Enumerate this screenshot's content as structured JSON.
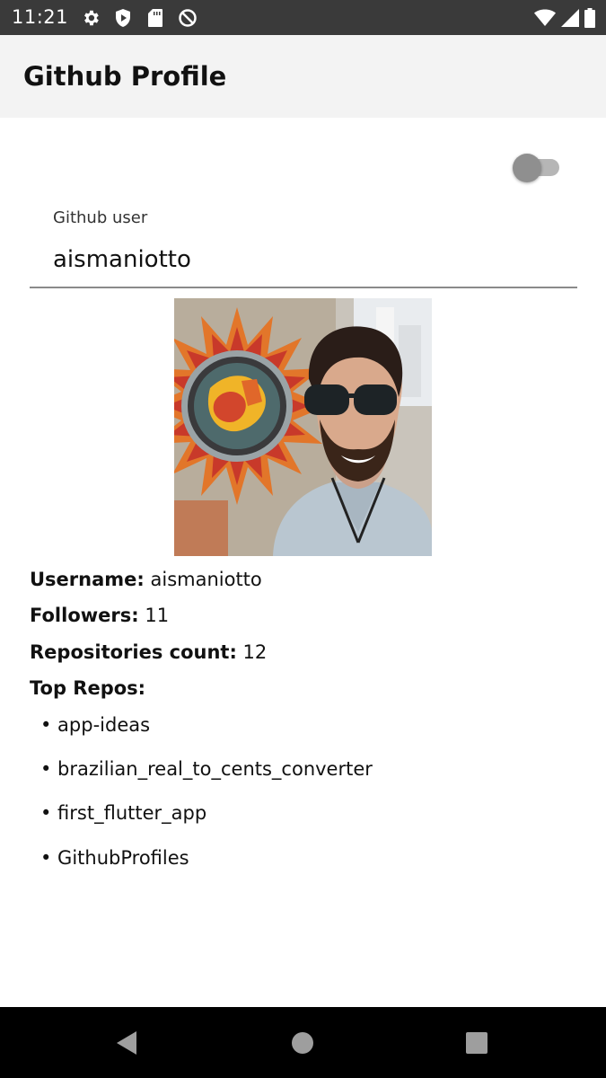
{
  "status_bar": {
    "time": "11:21",
    "left_icons": [
      "settings-icon",
      "shield-icon",
      "sd-card-icon",
      "no-sync-icon"
    ],
    "right_icons": [
      "wifi-icon",
      "cell-signal-icon",
      "battery-icon"
    ]
  },
  "app_bar": {
    "title": "Github Profile"
  },
  "theme_toggle": {
    "on": false
  },
  "search": {
    "label": "Github user",
    "value": "aismaniotto"
  },
  "avatar": {
    "icon": "profile-photo"
  },
  "profile": {
    "username_label": "Username:",
    "username": "aismaniotto",
    "followers_label": "Followers:",
    "followers": "11",
    "repos_count_label": "Repositories count:",
    "repos_count": "12",
    "top_repos_label": "Top Repos:"
  },
  "repos": [
    "• app-ideas",
    "• brazilian_real_to_cents_converter",
    "• first_flutter_app",
    "• GithubProfiles"
  ],
  "nav_bar": {
    "icons": [
      "back-icon",
      "home-icon",
      "recents-icon"
    ]
  },
  "colors": {
    "status_bar": "#3a3a3a",
    "app_bar": "#f3f3f3",
    "nav_bar": "#000000",
    "toggle": "#8f8f8f"
  }
}
